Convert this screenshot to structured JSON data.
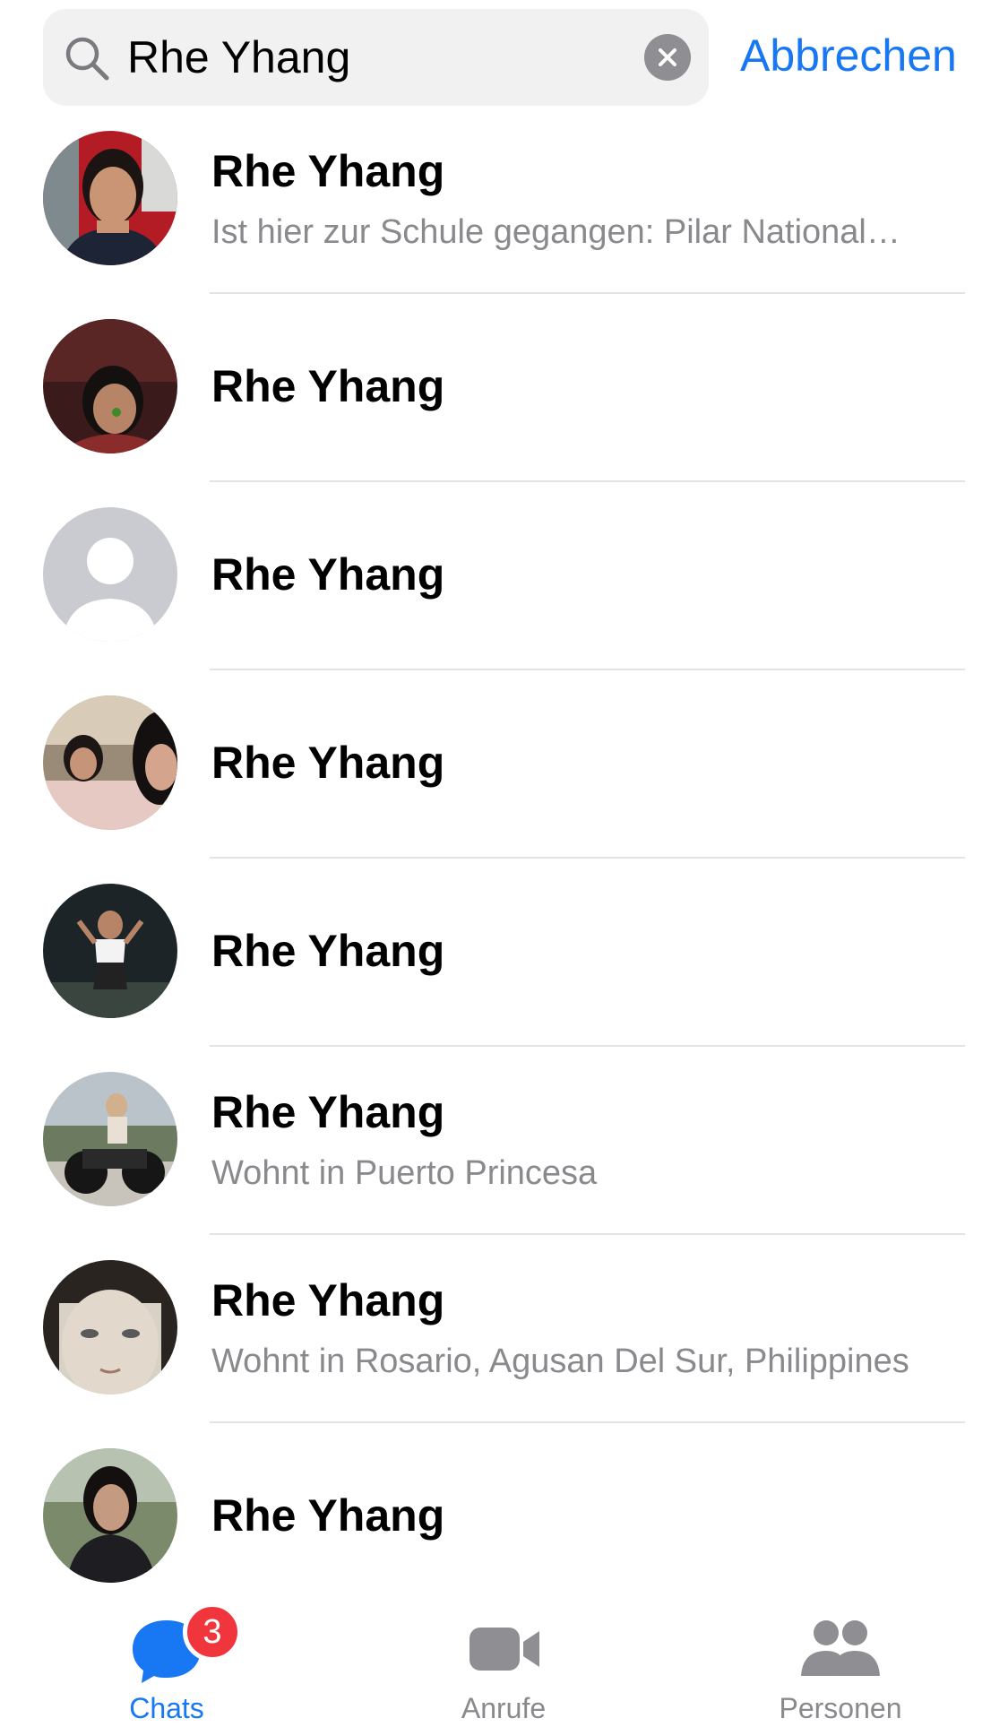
{
  "search": {
    "query": "Rhe Yhang",
    "cancel_label": "Abbrechen"
  },
  "results": [
    {
      "name": "Rhe Yhang",
      "subtitle": "Ist hier zur Schule gegangen: Pilar National…"
    },
    {
      "name": "Rhe Yhang",
      "subtitle": ""
    },
    {
      "name": "Rhe Yhang",
      "subtitle": ""
    },
    {
      "name": "Rhe Yhang",
      "subtitle": ""
    },
    {
      "name": "Rhe Yhang",
      "subtitle": ""
    },
    {
      "name": "Rhe Yhang",
      "subtitle": "Wohnt in Puerto Princesa"
    },
    {
      "name": "Rhe Yhang",
      "subtitle": "Wohnt in Rosario, Agusan Del Sur, Philippines"
    },
    {
      "name": "Rhe Yhang",
      "subtitle": ""
    }
  ],
  "tabbar": {
    "chats": {
      "label": "Chats",
      "badge": "3",
      "icon": "chat-bubble-icon"
    },
    "calls": {
      "label": "Anrufe",
      "icon": "video-camera-icon"
    },
    "people": {
      "label": "Personen",
      "icon": "people-icon"
    }
  },
  "colors": {
    "accent": "#1877f2",
    "badge": "#f0353d",
    "secondary_text": "#8a8a8e",
    "divider": "#e4e4e6",
    "search_bg": "#f1f1f1"
  }
}
